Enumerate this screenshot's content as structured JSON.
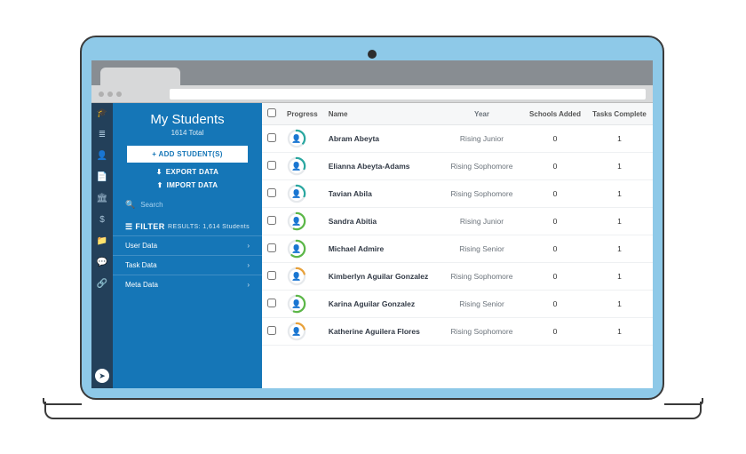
{
  "sidebar": {
    "title": "My Students",
    "subtitle": "1614 Total",
    "add_label": "ADD STUDENT(S)",
    "export_label": "EXPORT DATA",
    "import_label": "IMPORT DATA",
    "search_placeholder": "Search",
    "filter_label": "FILTER",
    "filter_results": "RESULTS: 1,614 Students",
    "filters": [
      {
        "label": "User Data"
      },
      {
        "label": "Task Data"
      },
      {
        "label": "Meta Data"
      }
    ]
  },
  "iconrail": {
    "items": [
      {
        "name": "grad-cap-icon",
        "glyph": "🎓",
        "active": true
      },
      {
        "name": "list-icon",
        "glyph": "≣"
      },
      {
        "name": "user-icon",
        "glyph": "👤"
      },
      {
        "name": "doc-icon",
        "glyph": "📄"
      },
      {
        "name": "bank-icon",
        "glyph": "🏛"
      },
      {
        "name": "dollar-icon",
        "glyph": "$"
      },
      {
        "name": "folder-icon",
        "glyph": "📁"
      },
      {
        "name": "chat-icon",
        "glyph": "💬"
      },
      {
        "name": "link-icon",
        "glyph": "🔗"
      }
    ],
    "send_glyph": "➤"
  },
  "table": {
    "headers": {
      "progress": "Progress",
      "name": "Name",
      "year": "Year",
      "schools": "Schools Added",
      "tasks": "Tasks Complete"
    },
    "rows": [
      {
        "name": "Abram Abeyta",
        "year": "Rising Junior",
        "schools": "0",
        "tasks": "1",
        "pct": 0.35,
        "color": "#2aa7a0"
      },
      {
        "name": "Elianna Abeyta-Adams",
        "year": "Rising Sophomore",
        "schools": "0",
        "tasks": "1",
        "pct": 0.3,
        "color": "#2aa7a0"
      },
      {
        "name": "Tavian Abila",
        "year": "Rising Sophomore",
        "schools": "0",
        "tasks": "1",
        "pct": 0.3,
        "color": "#2aa7a0"
      },
      {
        "name": "Sandra Abitia",
        "year": "Rising Junior",
        "schools": "0",
        "tasks": "1",
        "pct": 0.55,
        "color": "#5cb748"
      },
      {
        "name": "Michael Admire",
        "year": "Rising Senior",
        "schools": "0",
        "tasks": "1",
        "pct": 0.6,
        "color": "#5cb748"
      },
      {
        "name": "Kimberlyn Aguilar Gonzalez",
        "year": "Rising Sophomore",
        "schools": "0",
        "tasks": "1",
        "pct": 0.2,
        "color": "#e8a13a"
      },
      {
        "name": "Karina Aguilar Gonzalez",
        "year": "Rising Senior",
        "schools": "0",
        "tasks": "1",
        "pct": 0.55,
        "color": "#5cb748"
      },
      {
        "name": "Katherine Aguilera Flores",
        "year": "Rising Sophomore",
        "schools": "0",
        "tasks": "1",
        "pct": 0.2,
        "color": "#e8a13a"
      }
    ]
  }
}
